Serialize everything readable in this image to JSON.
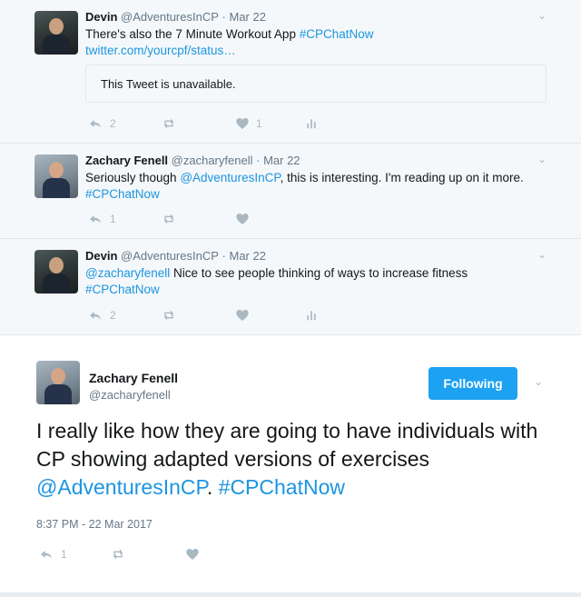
{
  "tweets": [
    {
      "name": "Devin",
      "handle": "@AdventuresInCP",
      "sep": "·",
      "date": "Mar 22",
      "text_plain": "There's also the 7 Minute Workout App ",
      "text_hashtag": "#CPChatNow",
      "text_link": "twitter.com/yourcpf/status…",
      "quote_text": "This Tweet is unavailable.",
      "replies": "2",
      "likes": "1"
    },
    {
      "name": "Zachary Fenell",
      "handle": "@zacharyfenell",
      "sep": "·",
      "date": "Mar 22",
      "text_a": "Seriously though ",
      "text_mention": "@AdventuresInCP",
      "text_b": ", this is interesting. I'm reading up on it more.",
      "text_hashtag": "#CPChatNow",
      "replies": "1"
    },
    {
      "name": "Devin",
      "handle": "@AdventuresInCP",
      "sep": "·",
      "date": "Mar 22",
      "text_mention": "@zacharyfenell",
      "text_b": " Nice to see people thinking of ways to increase fitness",
      "text_hashtag": "#CPChatNow",
      "replies": "2"
    }
  ],
  "main_tweet": {
    "name": "Zachary Fenell",
    "handle": "@zacharyfenell",
    "follow_label": "Following",
    "text_a": "I really like how they are going to have individuals with CP showing adapted versions of exercises ",
    "text_mention": "@AdventuresInCP",
    "text_b": ". ",
    "text_hashtag": "#CPChatNow",
    "timestamp": "8:37 PM - 22 Mar 2017",
    "replies": "1"
  },
  "icons": {
    "reply": "reply-icon",
    "retweet": "retweet-icon",
    "like": "heart-icon",
    "analytics": "analytics-icon",
    "more": "chevron-down-icon"
  },
  "colors": {
    "link": "#1b95e0",
    "follow_button": "#1da1f2",
    "icon_gray": "#aab8c2",
    "meta_gray": "#657786",
    "conversation_bg": "#f5f8fa"
  }
}
